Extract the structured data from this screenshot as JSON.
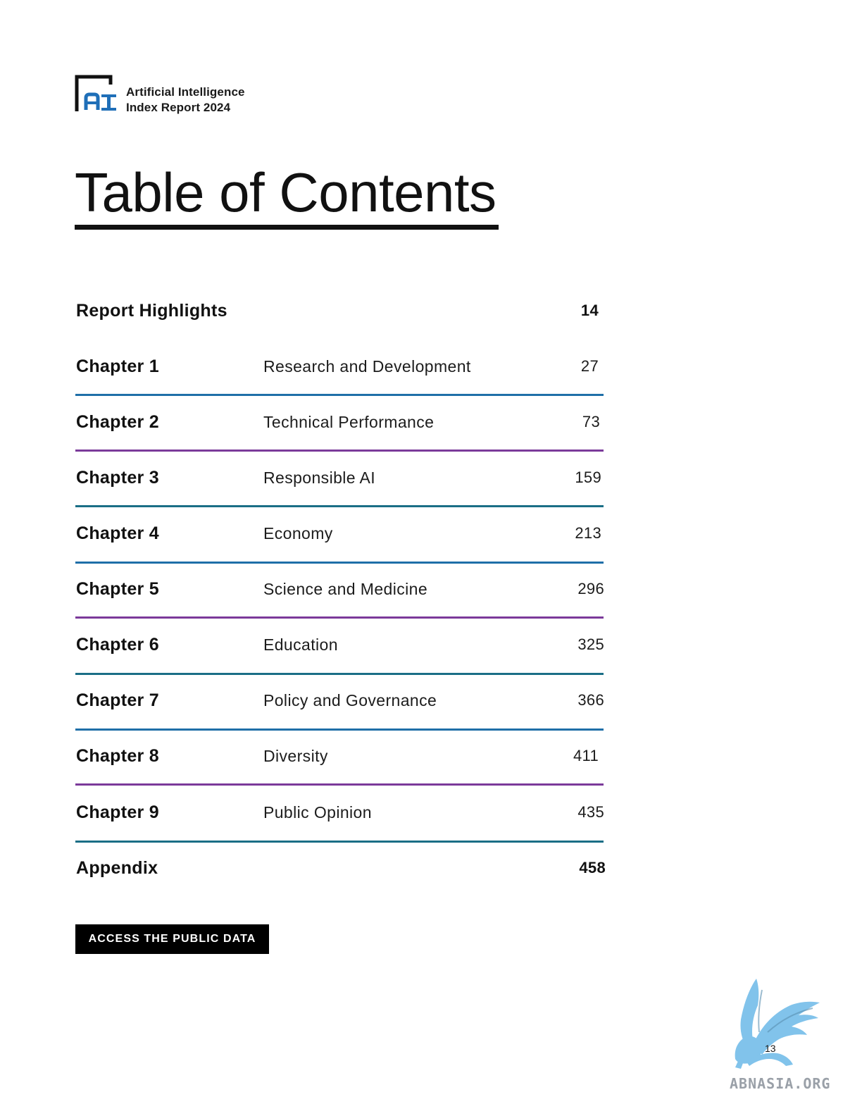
{
  "header": {
    "logo_line1": "Artificial Intelligence",
    "logo_line2": "Index Report 2024",
    "logo_colors": {
      "frame": "#111111",
      "letters": "#1f6fb8"
    }
  },
  "title": "Table of Contents",
  "toc": {
    "highlights": {
      "label": "Report Highlights",
      "page": "14"
    },
    "chapters": [
      {
        "label": "Chapter 1",
        "topic": "Research and Development",
        "page": "27",
        "color": "#1f6fa8"
      },
      {
        "label": "Chapter 2",
        "topic": "Technical Performance",
        "page": "73",
        "color": "#7b3a9a"
      },
      {
        "label": "Chapter 3",
        "topic": "Responsible AI",
        "page": "159",
        "color": "#1a6e86"
      },
      {
        "label": "Chapter 4",
        "topic": "Economy",
        "page": "213",
        "color": "#1f6fa8"
      },
      {
        "label": "Chapter 5",
        "topic": "Science and Medicine",
        "page": "296",
        "color": "#7b3a9a"
      },
      {
        "label": "Chapter 6",
        "topic": "Education",
        "page": "325",
        "color": "#1a6e86"
      },
      {
        "label": "Chapter 7",
        "topic": "Policy and Governance",
        "page": "366",
        "color": "#1f6fa8"
      },
      {
        "label": "Chapter 8",
        "topic": "Diversity",
        "page": "411",
        "color": "#7b3a9a"
      },
      {
        "label": "Chapter 9",
        "topic": "Public Opinion",
        "page": "435",
        "color": "#1a6e86"
      }
    ],
    "appendix": {
      "label": "Appendix",
      "page": "458"
    }
  },
  "public_data_button": "ACCESS THE PUBLIC DATA",
  "page_number": "13",
  "watermark": {
    "text": "ABNASIA.ORG",
    "color": "#6fb8e6"
  }
}
